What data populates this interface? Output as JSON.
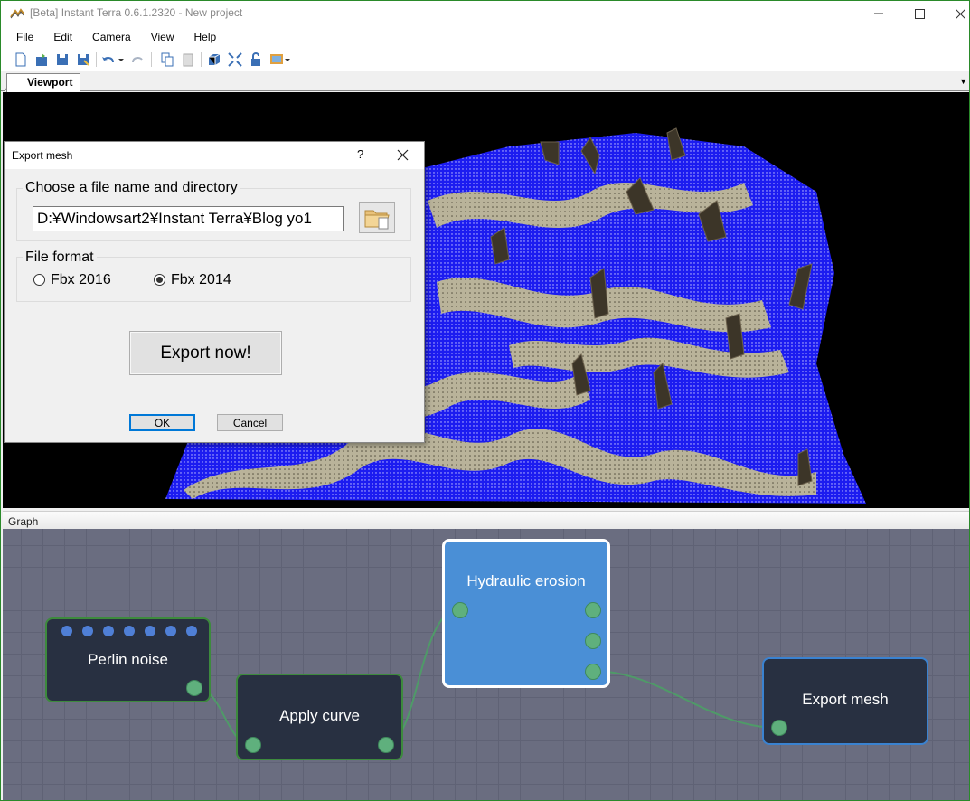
{
  "window": {
    "title": "[Beta] Instant Terra 0.6.1.2320 - New project"
  },
  "menu": {
    "items": [
      "File",
      "Edit",
      "Camera",
      "View",
      "Help"
    ]
  },
  "toolbar": {
    "icons": [
      "new-file-icon",
      "open-icon",
      "save-icon",
      "save-as-icon",
      "undo-icon",
      "redo-icon",
      "copy-icon",
      "paste-icon",
      "cube-view-icon",
      "fit-view-icon",
      "lock-icon",
      "image-menu-icon"
    ]
  },
  "tabs": {
    "viewport": "Viewport"
  },
  "graph": {
    "header": "Graph",
    "nodes": {
      "perlin": "Perlin noise",
      "curve": "Apply curve",
      "erosion": "Hydraulic erosion",
      "export": "Export mesh"
    }
  },
  "dialog": {
    "title": "Export mesh",
    "help_label": "?",
    "directory_group": "Choose a file name and directory",
    "path_value": "D:¥Windowsart2¥Instant Terra¥Blog yo1",
    "format_group": "File format",
    "format_options": [
      "Fbx 2016",
      "Fbx 2014"
    ],
    "selected_format": "Fbx 2014",
    "export_button": "Export now!",
    "ok": "OK",
    "cancel": "Cancel"
  },
  "colors": {
    "graph_bg": "#6a6d80",
    "node_dark": "#283041",
    "node_selected": "#4a8fd6",
    "port_green": "#5fb07d",
    "terrain_blue": "#1a1aff"
  }
}
